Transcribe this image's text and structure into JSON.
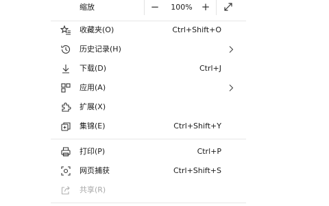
{
  "zoom": {
    "label": "缩放",
    "minus": "−",
    "value": "100%",
    "plus": "+"
  },
  "menu_items": [
    {
      "label": "收藏夹(O)",
      "shortcut": "Ctrl+Shift+O",
      "icon": "favorites-icon"
    },
    {
      "label": "历史记录(H)",
      "shortcut": "",
      "icon": "history-icon",
      "submenu": true
    },
    {
      "label": "下载(D)",
      "shortcut": "Ctrl+J",
      "icon": "download-icon"
    },
    {
      "label": "应用(A)",
      "shortcut": "",
      "icon": "apps-icon",
      "submenu": true
    },
    {
      "label": "扩展(X)",
      "shortcut": "",
      "icon": "extensions-icon"
    },
    {
      "label": "集锦(E)",
      "shortcut": "Ctrl+Shift+Y",
      "icon": "collections-icon"
    },
    {
      "label": "打印(P)",
      "shortcut": "Ctrl+P",
      "icon": "print-icon"
    },
    {
      "label": "网页捕获",
      "shortcut": "Ctrl+Shift+S",
      "icon": "web-capture-icon"
    },
    {
      "label": "共享(R)",
      "shortcut": "",
      "icon": "share-icon",
      "disabled": true
    }
  ]
}
